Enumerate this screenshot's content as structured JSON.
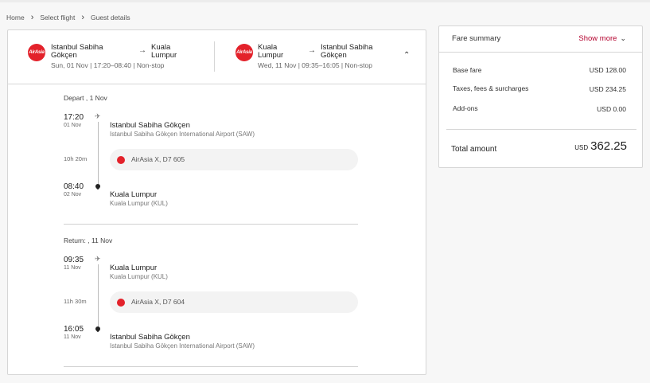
{
  "breadcrumb": [
    "Home",
    "Select flight",
    "Guest details"
  ],
  "outbound": {
    "logo": "AirAsia",
    "from": "Istanbul Sabiha Gökçen",
    "to": "Kuala Lumpur",
    "meta": "Sun, 01 Nov  |  17:20–08:40  |  Non-stop"
  },
  "inbound": {
    "logo": "AirAsia",
    "from": "Kuala Lumpur",
    "to": "Istanbul Sabiha Gökçen",
    "meta": "Wed, 11 Nov  |  09:35–16:05  |  Non-stop"
  },
  "depart": {
    "label": "Depart , 1 Nov",
    "dep_time": "17:20",
    "dep_date": "01 Nov",
    "dep_place": "Istanbul Sabiha Gökçen",
    "dep_airport": "Istanbul Sabiha Gökçen International Airport (SAW)",
    "duration": "10h 20m",
    "flight": "AirAsia X, D7 605",
    "arr_time": "08:40",
    "arr_date": "02 Nov",
    "arr_place": "Kuala Lumpur",
    "arr_airport": "Kuala Lumpur (KUL)"
  },
  "return": {
    "label": "Return: , 11 Nov",
    "dep_time": "09:35",
    "dep_date": "11 Nov",
    "dep_place": "Kuala Lumpur",
    "dep_airport": "Kuala Lumpur (KUL)",
    "duration": "11h 30m",
    "flight": "AirAsia X, D7 604",
    "arr_time": "16:05",
    "arr_date": "11 Nov",
    "arr_place": "Istanbul Sabiha Gökçen",
    "arr_airport": "Istanbul Sabiha Gökçen International Airport (SAW)"
  },
  "fare": {
    "title": "Fare summary",
    "show_more": "Show more",
    "rows": [
      {
        "label": "Base fare",
        "value": "USD 128.00"
      },
      {
        "label": "Taxes, fees & surcharges",
        "value": "USD 234.25"
      },
      {
        "label": "Add-ons",
        "value": "USD 0.00"
      }
    ],
    "total_label": "Total amount",
    "total_currency": "USD",
    "total_amount": "362.25"
  },
  "colors": {
    "brand": "#e3222b",
    "accent": "#b3002d"
  },
  "icons": [
    "chevron-right-icon",
    "arrow-right-icon",
    "chevron-up-icon",
    "chevron-down-icon",
    "plane-icon",
    "location-pin-icon"
  ]
}
